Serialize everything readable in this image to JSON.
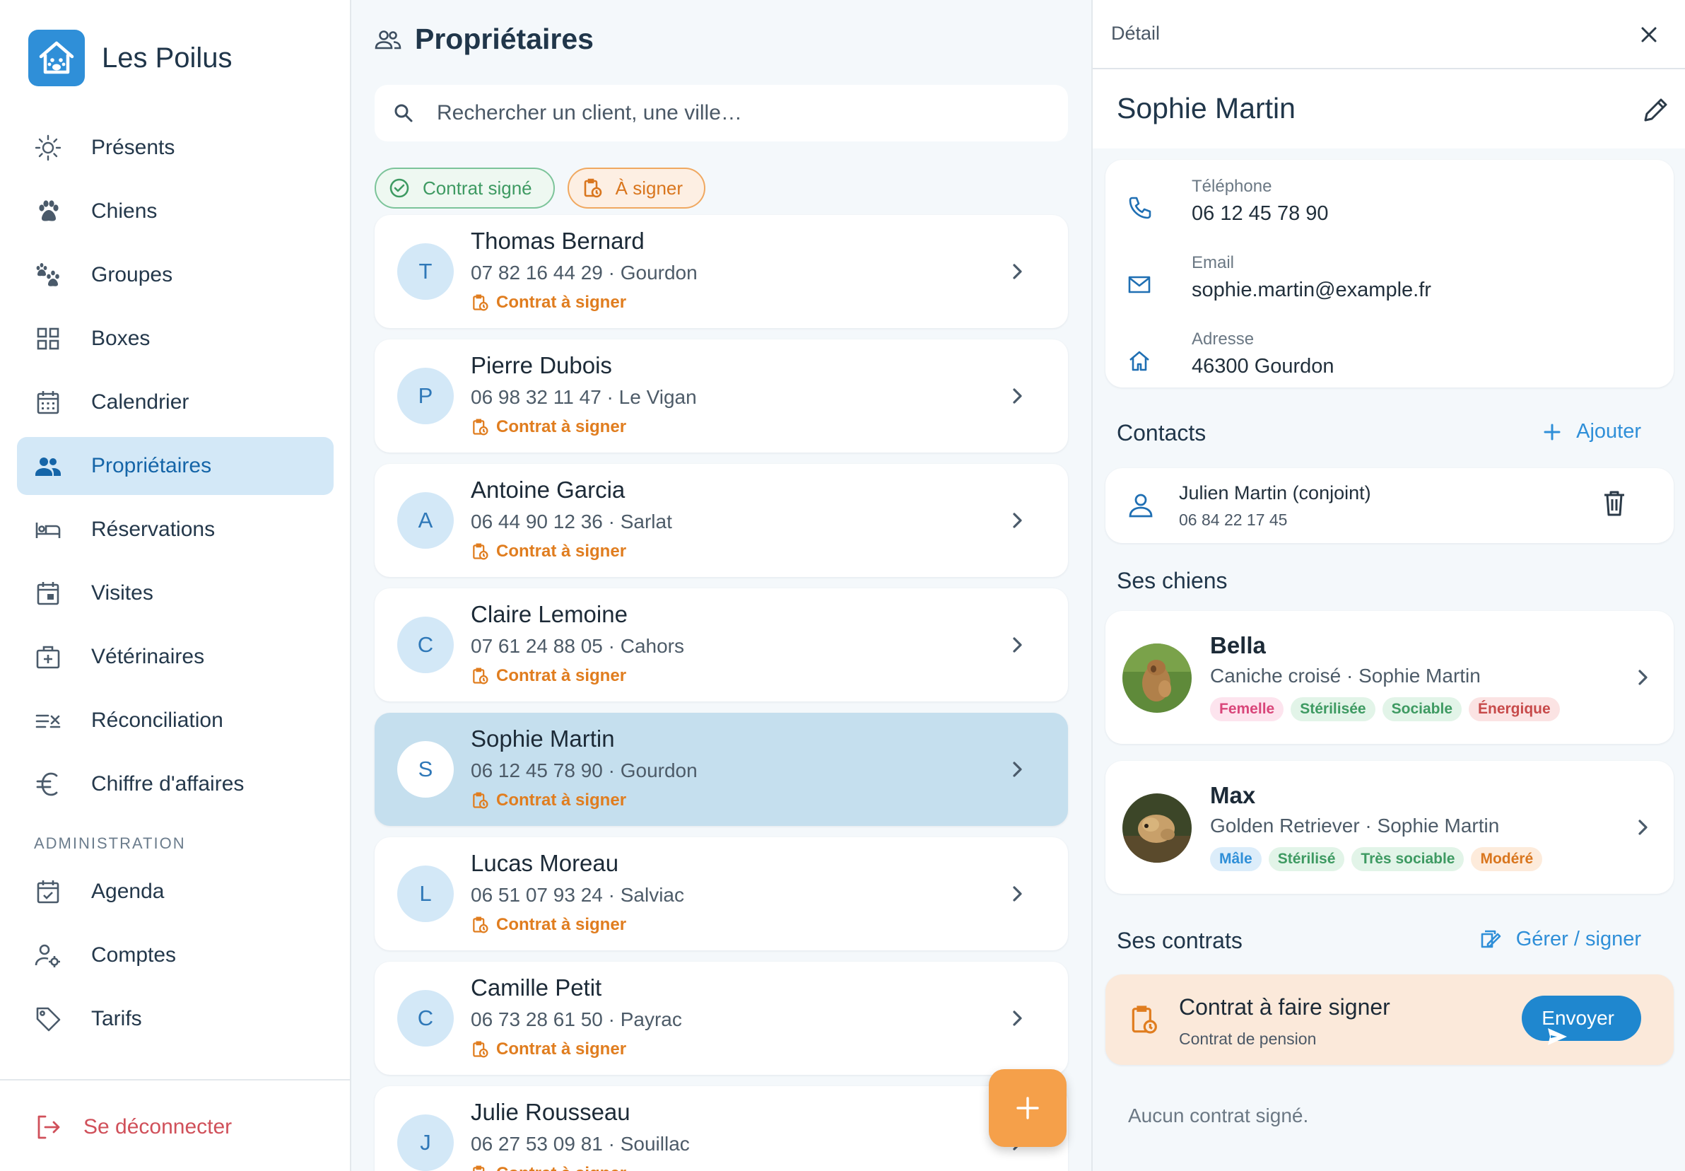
{
  "brand": {
    "name": "Les Poilus",
    "logo_icon": "house-paw-icon",
    "accent": "#2f8fd8"
  },
  "sidebar": {
    "items": [
      {
        "label": "Présents",
        "icon": "sun-icon"
      },
      {
        "label": "Chiens",
        "icon": "paw-icon"
      },
      {
        "label": "Groupes",
        "icon": "paws-icon"
      },
      {
        "label": "Boxes",
        "icon": "grid-icon"
      },
      {
        "label": "Calendrier",
        "icon": "calendar-icon"
      },
      {
        "label": "Propriétaires",
        "icon": "people-icon",
        "active": true
      },
      {
        "label": "Réservations",
        "icon": "bed-icon"
      },
      {
        "label": "Visites",
        "icon": "calendar-event-icon"
      },
      {
        "label": "Vétérinaires",
        "icon": "medical-icon"
      },
      {
        "label": "Réconciliation",
        "icon": "reconcile-icon"
      },
      {
        "label": "Chiffre d'affaires",
        "icon": "euro-icon"
      }
    ],
    "admin_section": "ADMINISTRATION",
    "admin_items": [
      {
        "label": "Agenda",
        "icon": "calendar-check-icon"
      },
      {
        "label": "Comptes",
        "icon": "user-cog-icon"
      },
      {
        "label": "Tarifs",
        "icon": "tag-icon"
      }
    ],
    "logout": "Se déconnecter"
  },
  "owners": {
    "title": "Propriétaires",
    "search_placeholder": "Rechercher un client, une ville…",
    "filters": [
      {
        "label": "Contrat signé",
        "icon": "check-circle-icon",
        "color": "#3e9a62"
      },
      {
        "label": "À signer",
        "icon": "clipboard-clock-icon",
        "color": "#d9761e"
      }
    ],
    "list": [
      {
        "initial": "T",
        "name": "Thomas Bernard",
        "meta": "07 82 16 44 29 · Gourdon",
        "status": "Contrat à signer"
      },
      {
        "initial": "P",
        "name": "Pierre Dubois",
        "meta": "06 98 32 11 47 · Le Vigan",
        "status": "Contrat à signer"
      },
      {
        "initial": "A",
        "name": "Antoine Garcia",
        "meta": "06 44 90 12 36 · Sarlat",
        "status": "Contrat à signer"
      },
      {
        "initial": "C",
        "name": "Claire Lemoine",
        "meta": "07 61 24 88 05 · Cahors",
        "status": "Contrat à signer"
      },
      {
        "initial": "S",
        "name": "Sophie Martin",
        "meta": "06 12 45 78 90 · Gourdon",
        "status": "Contrat à signer",
        "selected": true
      },
      {
        "initial": "L",
        "name": "Lucas Moreau",
        "meta": "06 51 07 93 24 · Salviac",
        "status": "Contrat à signer"
      },
      {
        "initial": "C",
        "name": "Camille Petit",
        "meta": "06 73 28 61 50 · Payrac",
        "status": "Contrat à signer"
      },
      {
        "initial": "J",
        "name": "Julie Rousseau",
        "meta": "06 27 53 09 81 · Souillac",
        "status": "Contrat à signer"
      }
    ]
  },
  "detail": {
    "header": "Détail",
    "name": "Sophie Martin",
    "info": [
      {
        "label": "Téléphone",
        "value": "06 12 45 78 90",
        "icon": "phone-icon"
      },
      {
        "label": "Email",
        "value": "sophie.martin@example.fr",
        "icon": "mail-icon"
      },
      {
        "label": "Adresse",
        "value": "46300 Gourdon",
        "icon": "home-icon"
      }
    ],
    "contacts_title": "Contacts",
    "add_label": "Ajouter",
    "contacts": [
      {
        "name": "Julien Martin (conjoint)",
        "phone": "06 84 22 17 45"
      }
    ],
    "dogs_title": "Ses chiens",
    "dogs": [
      {
        "name": "Bella",
        "meta": "Caniche croisé · Sophie Martin",
        "tags": [
          {
            "label": "Femelle",
            "fg": "#d9467a",
            "bg": "#fde4ee"
          },
          {
            "label": "Stérilisée",
            "fg": "#3e9a62",
            "bg": "#e2f4e8"
          },
          {
            "label": "Sociable",
            "fg": "#3e9a62",
            "bg": "#e2f4e8"
          },
          {
            "label": "Énergique",
            "fg": "#c74a4a",
            "bg": "#fbe3e3"
          }
        ]
      },
      {
        "name": "Max",
        "meta": "Golden Retriever · Sophie Martin",
        "tags": [
          {
            "label": "Mâle",
            "fg": "#2f8fd8",
            "bg": "#dcedfa"
          },
          {
            "label": "Stérilisé",
            "fg": "#3e9a62",
            "bg": "#e2f4e8"
          },
          {
            "label": "Très sociable",
            "fg": "#3e9a62",
            "bg": "#e2f4e8"
          },
          {
            "label": "Modéré",
            "fg": "#d9761e",
            "bg": "#fdebdb"
          }
        ]
      }
    ],
    "contracts_title": "Ses contrats",
    "manage_label": "Gérer / signer",
    "pending": {
      "title": "Contrat à faire signer",
      "subtitle": "Contrat de pension",
      "send_label": "Envoyer"
    },
    "empty": "Aucun contrat signé."
  }
}
